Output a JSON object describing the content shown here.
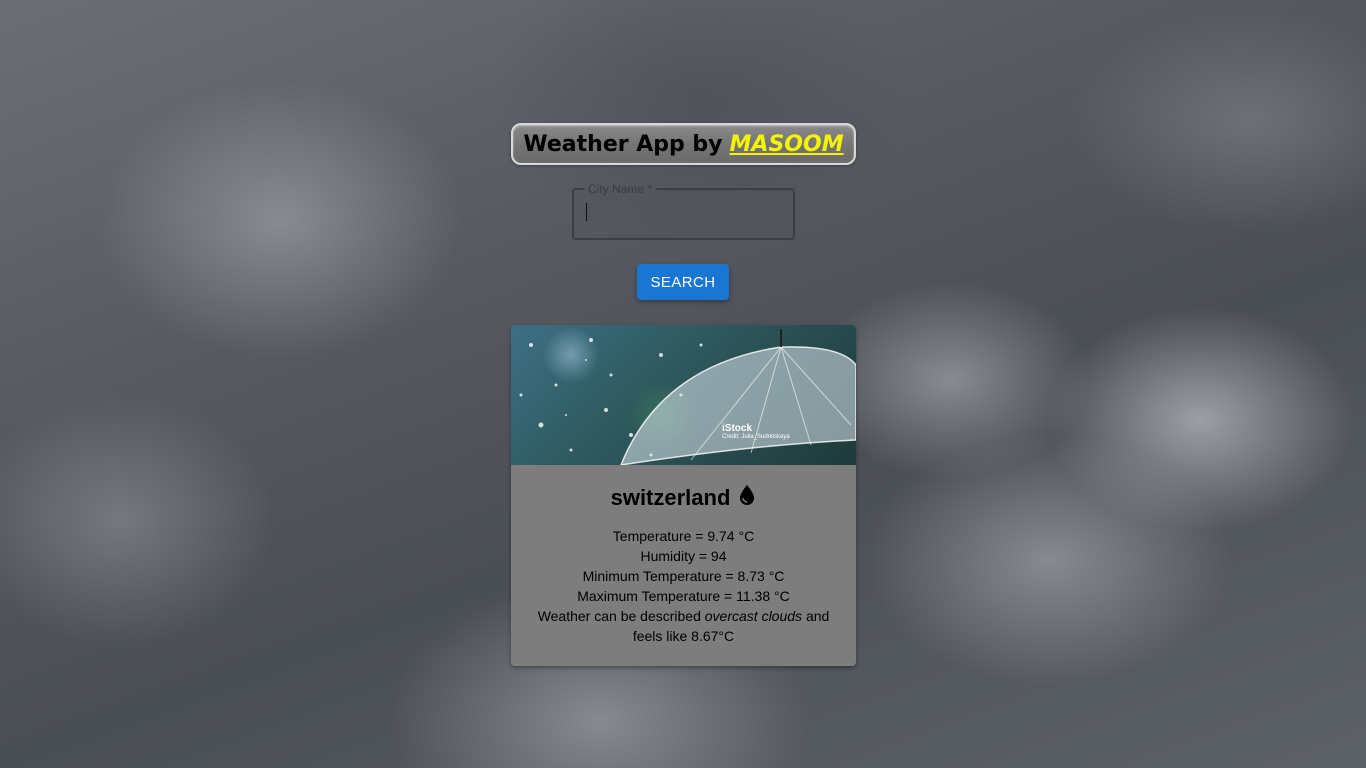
{
  "header": {
    "title_prefix": "Weather App by",
    "author": "MASOOM"
  },
  "search": {
    "label": "City Name *",
    "value": "",
    "button_label": "SEARCH"
  },
  "card": {
    "image_watermark": "iStock",
    "image_credit": "Credit: Julia_Sudnitskaya",
    "city": "switzerland",
    "icon": "water-drop-icon",
    "temperature": "Temperature = 9.74 °C",
    "humidity": "Humidity = 94",
    "min_temperature": "Minimum Temperature = 8.73 °C",
    "max_temperature": "Maximum Temperature = 11.38 °C",
    "description_prefix": "Weather can be described",
    "description": "overcast clouds",
    "description_suffix": "and feels like 8.67°C"
  },
  "colors": {
    "button": "#1976d2",
    "author": "#f4f400",
    "card_background": "#7d7d7d"
  }
}
